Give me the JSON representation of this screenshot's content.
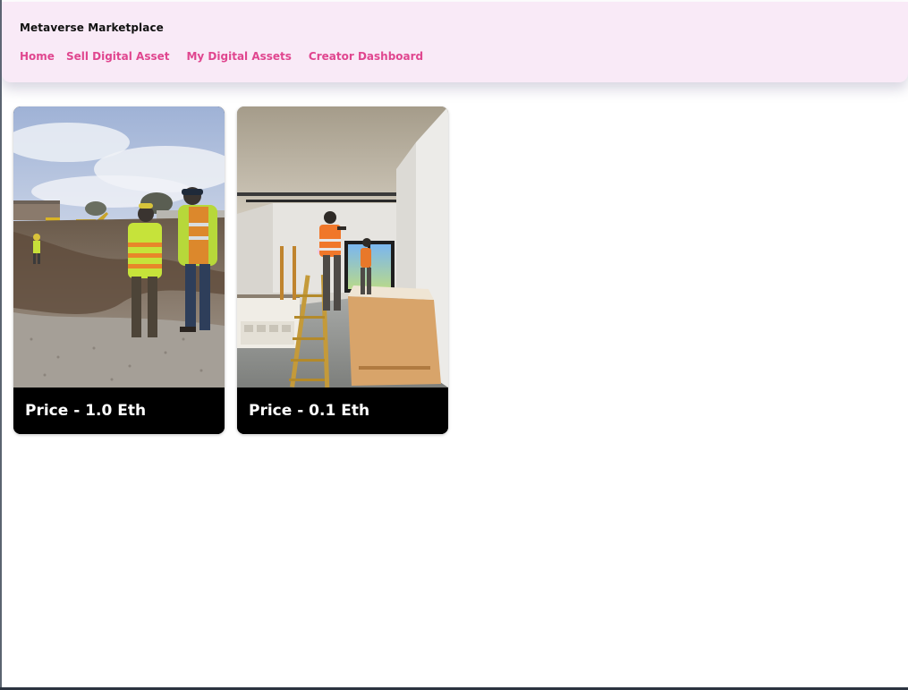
{
  "navbar": {
    "brand": "Metaverse Marketplace",
    "links": [
      {
        "label": "Home"
      },
      {
        "label": "Sell Digital Asset"
      },
      {
        "label": "My Digital Assets"
      },
      {
        "label": "Creator Dashboard"
      }
    ],
    "background": "#f9eaf7",
    "link_color": "#e0468f"
  },
  "assets": [
    {
      "image": "construction-site-workers-photo",
      "price": "Price - 1.0 Eth"
    },
    {
      "image": "interior-construction-ladder-photo",
      "price": "Price - 0.1 Eth"
    }
  ]
}
